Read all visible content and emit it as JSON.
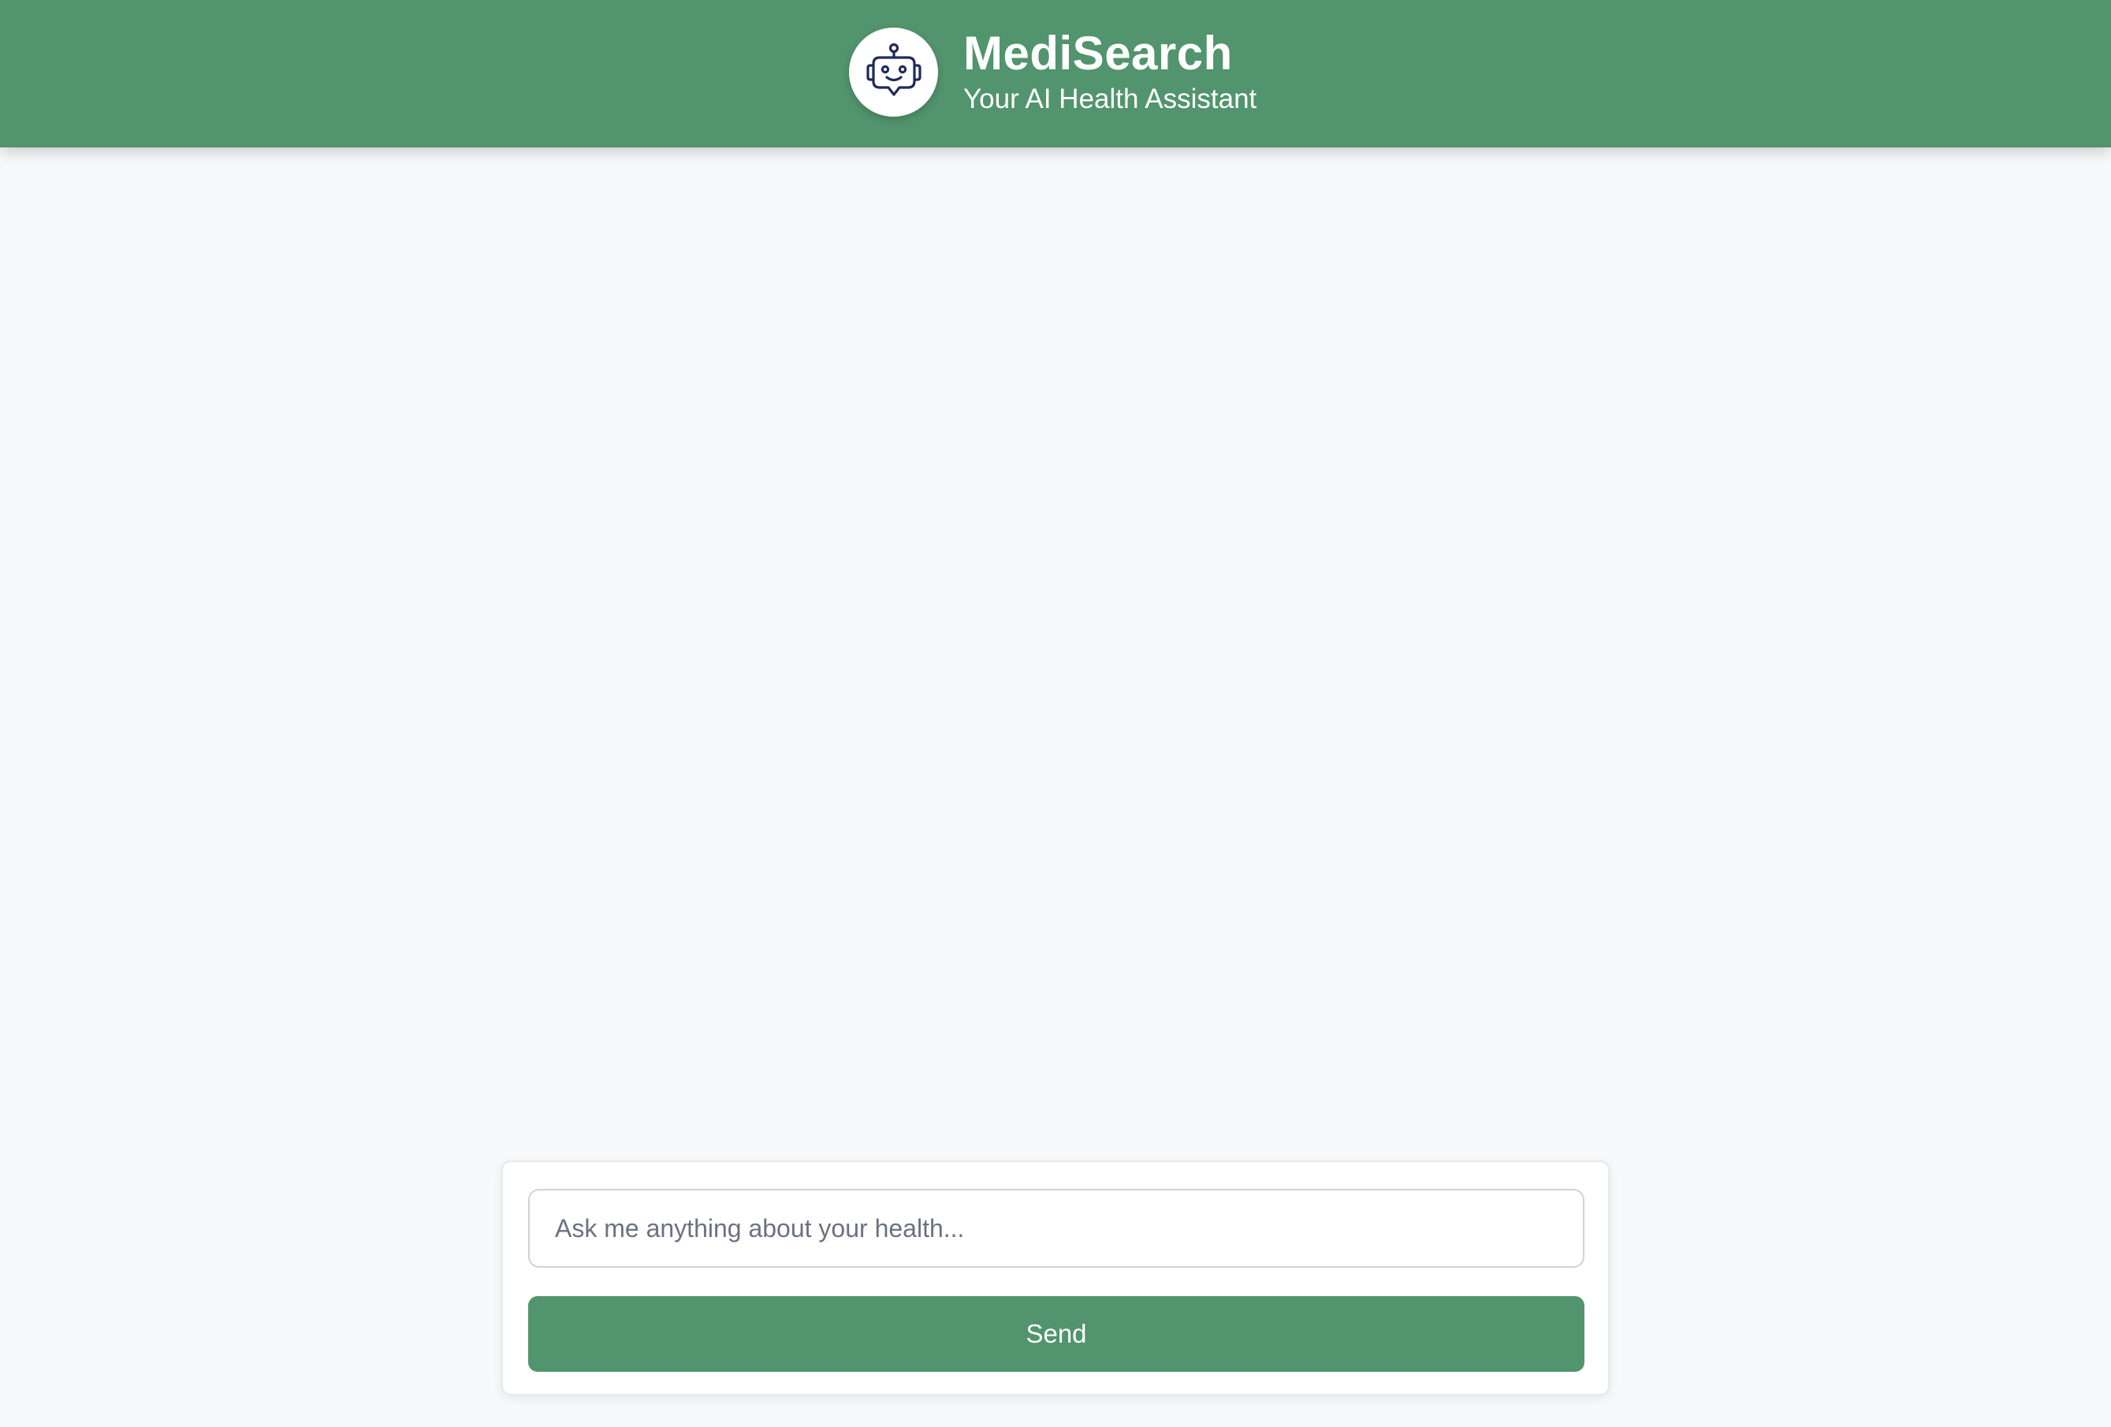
{
  "header": {
    "title": "MediSearch",
    "subtitle": "Your AI Health Assistant",
    "logo_icon": "robot-chat-icon",
    "background_color": "#52946d"
  },
  "composer": {
    "input_placeholder": "Ask me anything about your health...",
    "input_value": "",
    "send_label": "Send",
    "button_color": "#52946d"
  },
  "chat": {
    "messages": []
  }
}
